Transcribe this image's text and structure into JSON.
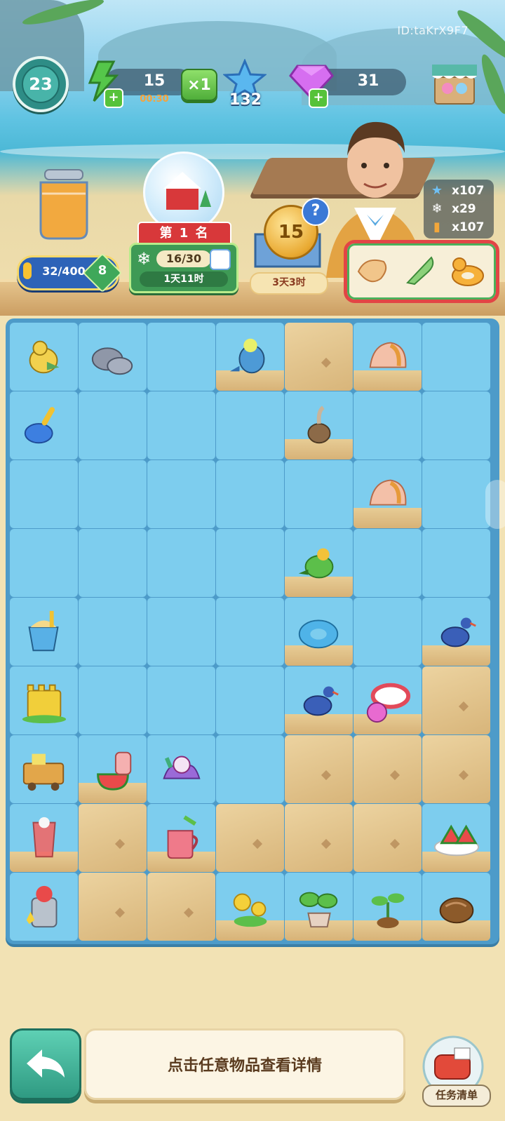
{
  "header": {
    "user_id": "ID:taKrX9F7",
    "level": "23",
    "energy": {
      "value": "15",
      "timer": "00:30",
      "multiplier": "×1"
    },
    "stars": "132",
    "gems": "31"
  },
  "jar": {
    "progress_text": "32/400",
    "level": "8",
    "progress_fraction": 0.08
  },
  "event": {
    "rank": "第 1 名",
    "count": "16/30",
    "timer": "1天11时"
  },
  "coin_event": {
    "coin_value": "15",
    "help": "?",
    "timer": "3天3时"
  },
  "rewards": [
    {
      "icon": "star-icon",
      "value": "x107"
    },
    {
      "icon": "snowflake-icon",
      "value": "x29"
    },
    {
      "icon": "juice-icon",
      "value": "x107"
    }
  ],
  "order_items": [
    "conch-shell-icon",
    "spiral-shell-icon",
    "duck-float-icon"
  ],
  "board": {
    "cols": 7,
    "rows": [
      [
        "yellow-bird",
        "stone",
        "empty",
        "cockatiel",
        "sand",
        "hermit-shell",
        "empty"
      ],
      [
        "blue-shovel",
        "empty",
        "empty",
        "empty",
        "brown-bird",
        "empty",
        "empty"
      ],
      [
        "empty",
        "empty",
        "empty",
        "empty",
        "empty",
        "hermit-shell",
        "empty"
      ],
      [
        "empty",
        "empty",
        "empty",
        "empty",
        "green-parrot",
        "empty",
        "empty"
      ],
      [
        "sand-bucket",
        "empty",
        "empty",
        "empty",
        "swim-ring",
        "empty",
        "blue-pigeon"
      ],
      [
        "sandcastle",
        "empty",
        "empty",
        "empty",
        "blue-pigeon",
        "ring-and-ball",
        "sand"
      ],
      [
        "supply-cart",
        "watermelon-drink",
        "coral-candy",
        "empty",
        "sand",
        "sand",
        "sand"
      ],
      [
        "juice-glass",
        "sand",
        "punch-pitcher",
        "sand",
        "sand",
        "sand",
        "watermelon-plate"
      ],
      [
        "juicer",
        "sand",
        "sand",
        "yellow-flowers",
        "potted-plant",
        "sprout",
        "seed"
      ]
    ]
  },
  "footer": {
    "hint": "点击任意物品查看详情",
    "tasks_label": "任务清单"
  }
}
